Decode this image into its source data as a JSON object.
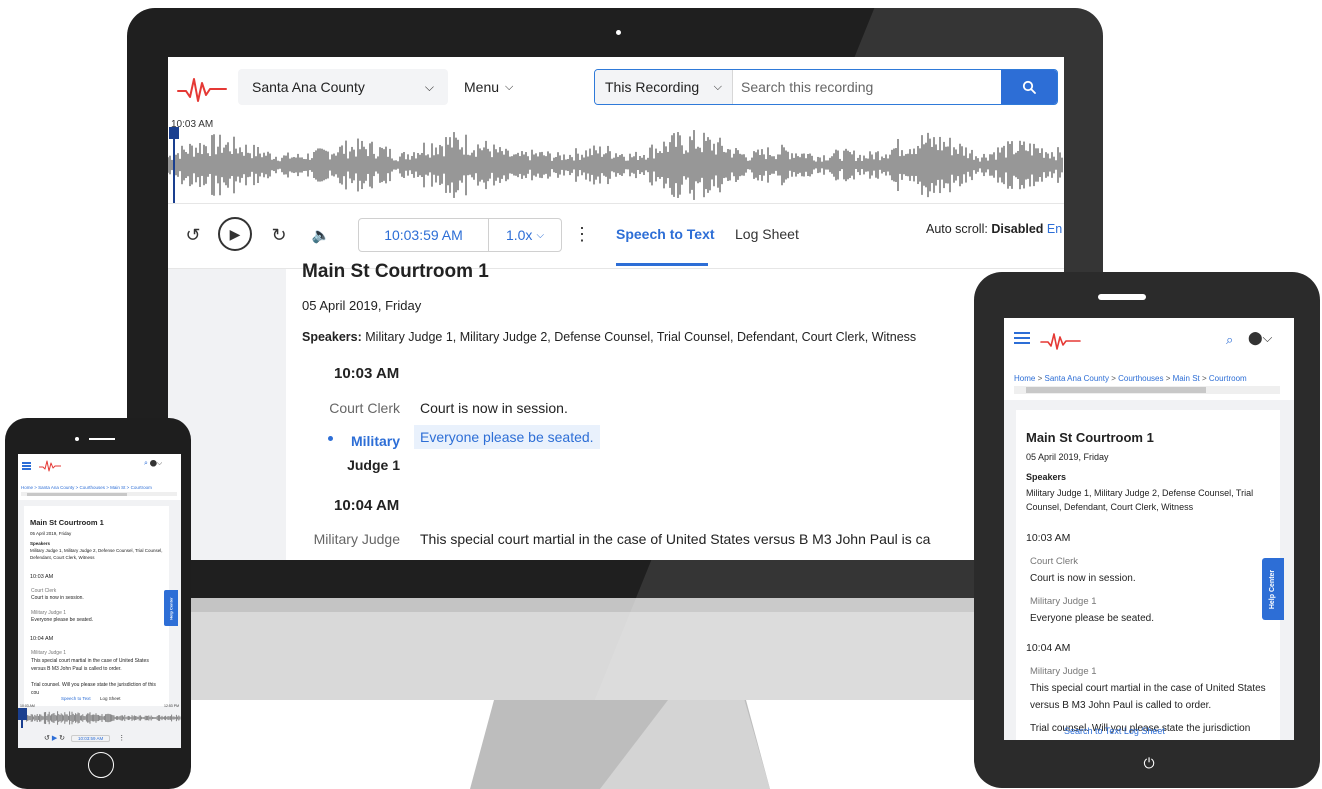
{
  "desktop": {
    "header": {
      "county": "Santa Ana County",
      "menu_label": "Menu",
      "search_scope": "This Recording",
      "search_placeholder": "Search this recording"
    },
    "waveform": {
      "start_time": "10:03 AM"
    },
    "controls": {
      "current_time": "10:03:59 AM",
      "rate": "1.0x",
      "tabs": [
        "Speech to Text",
        "Log Sheet"
      ],
      "autoscroll_label": "Auto scroll:",
      "autoscroll_value": "Disabled",
      "autoscroll_link": "En"
    },
    "transcript": {
      "title": "Main St Courtroom 1",
      "date": "05 April 2019, Friday",
      "speakers_label": "Speakers:",
      "speakers": "Military Judge 1, Military Judge 2, Defense Counsel, Trial Counsel, Defendant, Court Clerk, Witness",
      "blocks": [
        {
          "time": "10:03 AM"
        },
        {
          "speaker": "Court Clerk",
          "text": "Court is now in session."
        },
        {
          "speaker_line1": "Military",
          "speaker_line2": "Judge 1",
          "text": "Everyone please be seated."
        },
        {
          "time": "10:04 AM"
        },
        {
          "speaker": "Military Judge",
          "text": "This special court martial in the case of United States versus B M3 John Paul is ca"
        }
      ]
    }
  },
  "tablet": {
    "breadcrumb": [
      "Home",
      "Santa Ana County",
      "Courthouses",
      "Main St",
      "Courtroom"
    ],
    "title": "Main St Courtroom 1",
    "date": "05 April 2019, Friday",
    "speakers_label": "Speakers",
    "speakers": "Military Judge 1, Military Judge 2, Defense Counsel, Trial Counsel, Defendant, Court Clerk, Witness",
    "time1": "10:03 AM",
    "speaker1": "Court Clerk",
    "text1": "Court is now in session.",
    "speaker2": "Military Judge 1",
    "text2": "Everyone please be seated.",
    "time2": "10:04 AM",
    "speaker3": "Military Judge 1",
    "text3": "This special court martial in the case of United States versus B M3 John Paul is called to order.",
    "text4": "Trial counsel. Will you please state the jurisdiction",
    "tabs_overlay": "Search to Text   Log Sheet",
    "help": "Help Center"
  },
  "phone": {
    "breadcrumb": "Home > Santa Ana County > Courthouses > Main St > Courtroom",
    "title": "Main St Courtroom 1",
    "date": "05 April 2019, Friday",
    "speakers_label": "Speakers",
    "speakers": "Military Judge 1, Military Judge 2, Defense Counsel, Trial Counsel, Defendant, Court Clerk, Witness",
    "time1": "10:03 AM",
    "speaker1": "Court Clerk",
    "text1": "Court is now in session.",
    "speaker2": "Military Judge 1",
    "text2": "Everyone please be seated.",
    "time2": "10:04 AM",
    "speaker3": "Military Judge 1",
    "text3": "This special court martial in the case of United States versus B M3 John Paul is called to order.",
    "text4": "Trial counsel. Will you please state the jurisdiction of this cou",
    "tab1": "Speech to Text",
    "tab2": "Log Sheet",
    "wave_start": "10:03 AM",
    "wave_end": "12:53 PM",
    "current_time": "10:03:59 AM",
    "help": "Help Center"
  },
  "colors": {
    "accent": "#2d6ed6",
    "logo_red": "#e53935"
  }
}
